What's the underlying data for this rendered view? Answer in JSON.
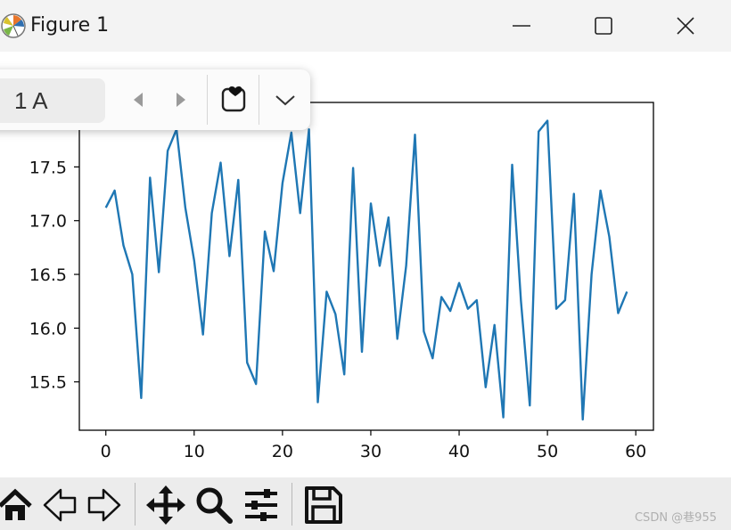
{
  "window": {
    "title": "Figure 1",
    "controls": {
      "minimize": "minimize",
      "maximize": "maximize",
      "close": "close"
    }
  },
  "floating_toolbar": {
    "page_value": "1 A",
    "icons": [
      "prev-page-icon",
      "next-page-icon",
      "pinned-heart-icon",
      "chevron-down-icon"
    ]
  },
  "nav_toolbar": {
    "icons": [
      "home-icon",
      "back-arrow-icon",
      "forward-arrow-icon",
      "pan-move-icon",
      "zoom-magnifier-icon",
      "configure-subplots-icon",
      "save-icon"
    ]
  },
  "watermark": "CSDN @巷955",
  "chart_data": {
    "type": "line",
    "title": "",
    "xlabel": "",
    "ylabel": "",
    "xlim": [
      -3,
      62
    ],
    "ylim": [
      15.05,
      18.1
    ],
    "xticks": [
      0,
      10,
      20,
      30,
      40,
      50,
      60
    ],
    "xtick_labels": [
      "0",
      "10",
      "20",
      "30",
      "40",
      "50",
      "60"
    ],
    "yticks": [
      15.5,
      16.0,
      16.5,
      17.0,
      17.5
    ],
    "ytick_labels": [
      "15.5",
      "16.0",
      "16.5",
      "17.0",
      "17.5"
    ],
    "grid": false,
    "series": [
      {
        "color": "#1f77b4",
        "x": [
          0,
          1,
          2,
          3,
          4,
          5,
          6,
          7,
          8,
          9,
          10,
          11,
          12,
          13,
          14,
          15,
          16,
          17,
          18,
          19,
          20,
          21,
          22,
          23,
          24,
          25,
          26,
          27,
          28,
          29,
          30,
          31,
          32,
          33,
          34,
          35,
          36,
          37,
          38,
          39,
          40,
          41,
          42,
          43,
          44,
          45,
          46,
          47,
          48,
          49,
          50,
          51,
          52,
          53,
          54,
          55,
          56,
          57,
          58,
          59
        ],
        "values": [
          17.12,
          17.28,
          16.77,
          16.5,
          15.35,
          17.4,
          16.52,
          17.65,
          17.85,
          17.12,
          16.63,
          15.94,
          17.07,
          17.54,
          16.67,
          17.38,
          15.68,
          15.48,
          16.9,
          16.53,
          17.35,
          17.82,
          17.07,
          17.85,
          15.31,
          16.34,
          16.13,
          15.57,
          17.49,
          15.78,
          17.16,
          16.58,
          17.03,
          15.9,
          16.58,
          17.8,
          15.97,
          15.72,
          16.29,
          16.16,
          16.42,
          16.18,
          16.26,
          15.45,
          16.03,
          15.17,
          17.52,
          16.25,
          15.28,
          17.83,
          17.93,
          16.18,
          16.26,
          17.25,
          15.15,
          16.5,
          17.28,
          16.85,
          16.14,
          16.34
        ]
      }
    ]
  }
}
